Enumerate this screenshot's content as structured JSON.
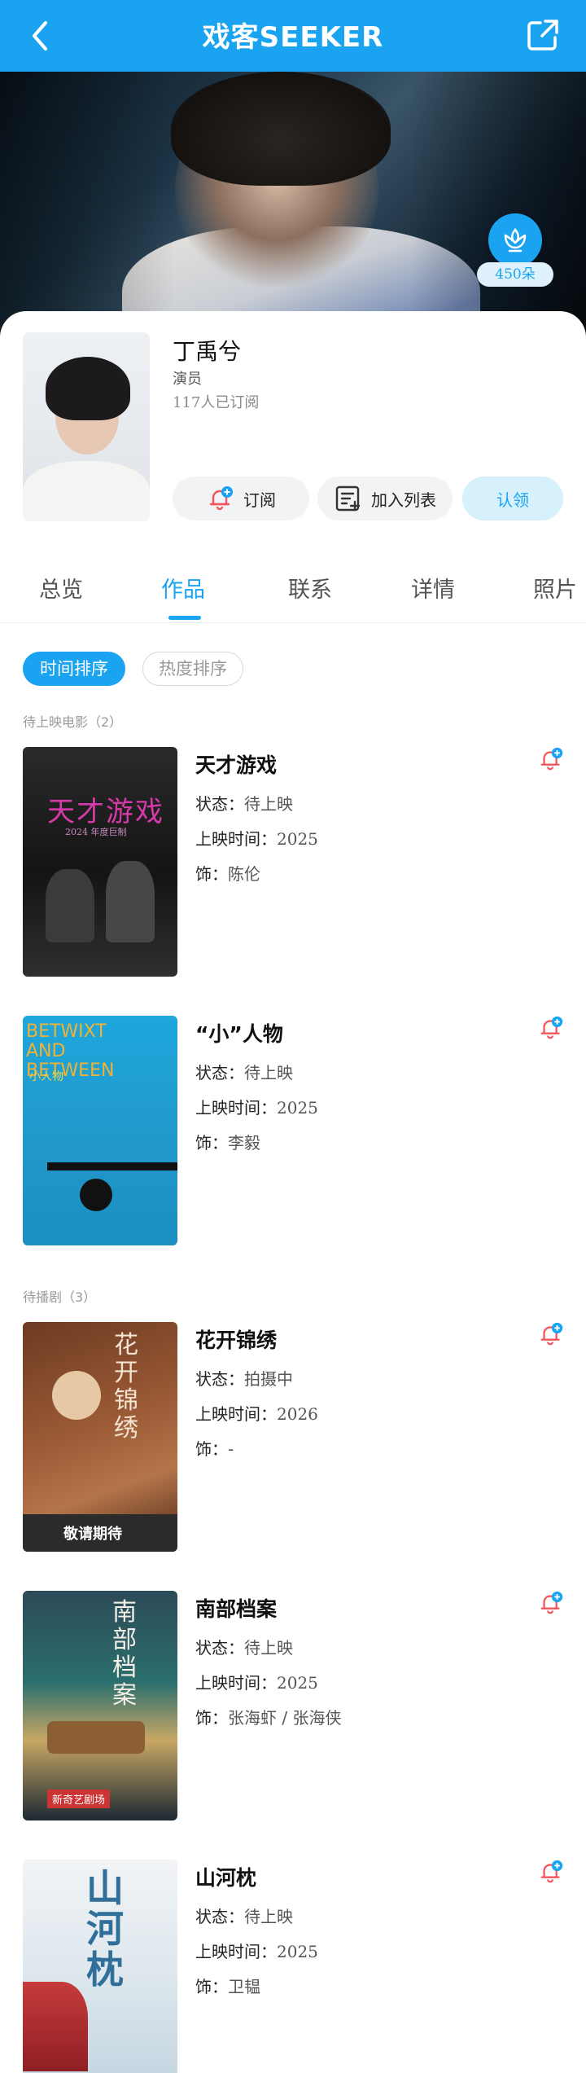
{
  "header": {
    "title": "戏客SEEKER",
    "back_icon": "chevron-left-icon",
    "share_icon": "share-icon"
  },
  "hero": {
    "flower_count": "450朵",
    "flower_icon": "flower-icon"
  },
  "profile": {
    "name": "丁禹兮",
    "role": "演员",
    "subscribers": "117人已订阅",
    "subscribe_label": "订阅",
    "add_to_list_label": "加入列表",
    "claim_label": "认领"
  },
  "tabs": [
    {
      "label": "总览"
    },
    {
      "label": "作品"
    },
    {
      "label": "联系"
    },
    {
      "label": "详情"
    },
    {
      "label": "照片"
    }
  ],
  "active_tab": "作品",
  "sort": {
    "time_label": "时间排序",
    "hot_label": "热度排序",
    "active": "时间排序"
  },
  "labels": {
    "status": "状态：",
    "release": "上映时间：",
    "character": "饰："
  },
  "sections": [
    {
      "title": "待上映电影（2）",
      "works": [
        {
          "title": "天才游戏",
          "status": "待上映",
          "release": "2025",
          "character": "陈伦",
          "poster_text": "天才游戏",
          "poster_sub": "2024 年度巨制"
        },
        {
          "title": "“小”人物",
          "status": "待上映",
          "release": "2025",
          "character": "李毅",
          "poster_text": "BETWIXT AND BETWEEN",
          "poster_sub": "小人物"
        }
      ]
    },
    {
      "title": "待播剧（3）",
      "works": [
        {
          "title": "花开锦绣",
          "status": "拍摄中",
          "release": "2026",
          "character": "-",
          "poster_text": "花开锦绣",
          "poster_sub": "敬请期待"
        },
        {
          "title": "南部档案",
          "status": "待上映",
          "release": "2025",
          "character": "张海虾 / 张海侠",
          "poster_text": "南部档案",
          "poster_sub": "新奇艺剧场"
        },
        {
          "title": "山河枕",
          "status": "待上映",
          "release": "2025",
          "character": "卫韫",
          "poster_text": "山河枕",
          "poster_sub": ""
        }
      ]
    }
  ],
  "colors": {
    "brand": "#1aa3f0",
    "bell_red": "#f2545b"
  }
}
